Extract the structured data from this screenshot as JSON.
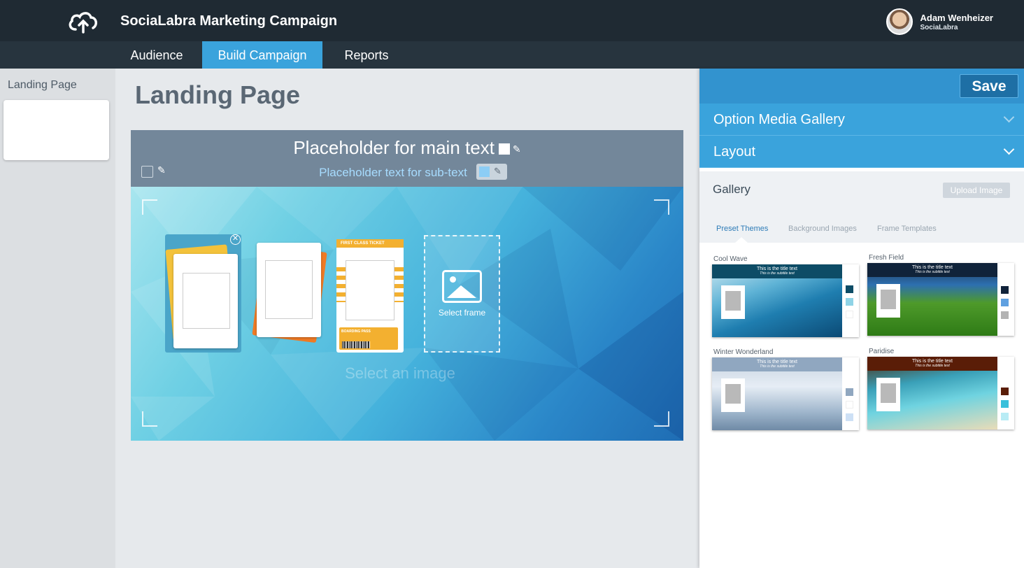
{
  "header": {
    "app_title": "SociaLabra Marketing Campaign",
    "user_name": "Adam Wenheizer",
    "user_org": "SociaLabra"
  },
  "nav": {
    "tabs": [
      {
        "label": "Audience",
        "active": false
      },
      {
        "label": "Build Campaign",
        "active": true
      },
      {
        "label": "Reports",
        "active": false
      }
    ]
  },
  "sidebar": {
    "label": "Landing Page"
  },
  "main": {
    "title": "Landing Page",
    "main_text": "Placeholder for main text",
    "sub_text": "Placeholder text for sub-text",
    "frame_ticket_label": "FIRST CLASS TICKET",
    "frame_boarding_label": "BOARDING PASS",
    "select_frame_label": "Select frame",
    "select_image_label": "Select an image"
  },
  "panel": {
    "save_label": "Save",
    "accordion": [
      {
        "label": "Option Media Gallery"
      },
      {
        "label": "Layout"
      }
    ],
    "gallery_title": "Gallery",
    "upload_label": "Upload Image",
    "gallery_tabs": [
      {
        "label": "Preset Themes",
        "active": true
      },
      {
        "label": "Background Images",
        "active": false
      },
      {
        "label": "Frame Templates",
        "active": false
      }
    ],
    "themes": [
      {
        "name": "Cool Wave",
        "title": "This is the title text",
        "subtitle": "This is the subtitle text",
        "bar_color": "#0d4c66",
        "swatches": [
          "#0d4c66",
          "#8fd3e6",
          "#ffffff"
        ]
      },
      {
        "name": "Fresh Field",
        "title": "This is the title text",
        "subtitle": "This is the subtitle text",
        "bar_color": "#10233a",
        "swatches": [
          "#10233a",
          "#5fa0e0",
          "#b3b3b3"
        ]
      },
      {
        "name": "Winter Wonderland",
        "title": "This is the title text",
        "subtitle": "This is the subtitle text",
        "bar_color": "#90a7c0",
        "swatches": [
          "#90a7c0",
          "#ffffff",
          "#cde0f5"
        ]
      },
      {
        "name": "Paridise",
        "title": "This is the title text",
        "subtitle": "This is the subtitle text",
        "bar_color": "#5a1d07",
        "swatches": [
          "#5a1d07",
          "#39c0db",
          "#b8ecf5"
        ]
      }
    ]
  },
  "colors": {
    "topbar": "#1f2a33",
    "accent": "#3aa3dc",
    "save_button": "#1e6fa5"
  }
}
